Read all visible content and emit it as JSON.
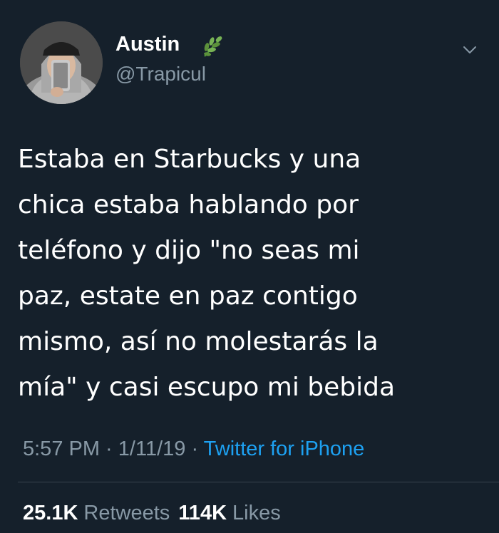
{
  "user": {
    "display_name": "Austin",
    "name_emoji": "herb-icon",
    "handle": "@Trapicul",
    "avatar": "avatar"
  },
  "tweet": {
    "text": "Estaba en Starbucks y una\nchica estaba hablando por\nteléfono y dijo \"no seas mi\npaz, estate en paz contigo\nmismo, así no molestarás la\nmía\" y casi escupo mi bebida"
  },
  "meta": {
    "time": "5:57 PM",
    "separator": " · ",
    "date": "1/11/19",
    "separator2": " · ",
    "source": "Twitter for iPhone"
  },
  "stats": {
    "retweets_count": "25.1K",
    "retweets_label": "Retweets",
    "likes_count": "114K",
    "likes_label": "Likes"
  },
  "icons": {
    "menu": "chevron-down-icon"
  },
  "colors": {
    "background": "#15202b",
    "text": "#ffffff",
    "secondary": "#8899a6",
    "link": "#1da1f2",
    "divider": "#38444d"
  }
}
